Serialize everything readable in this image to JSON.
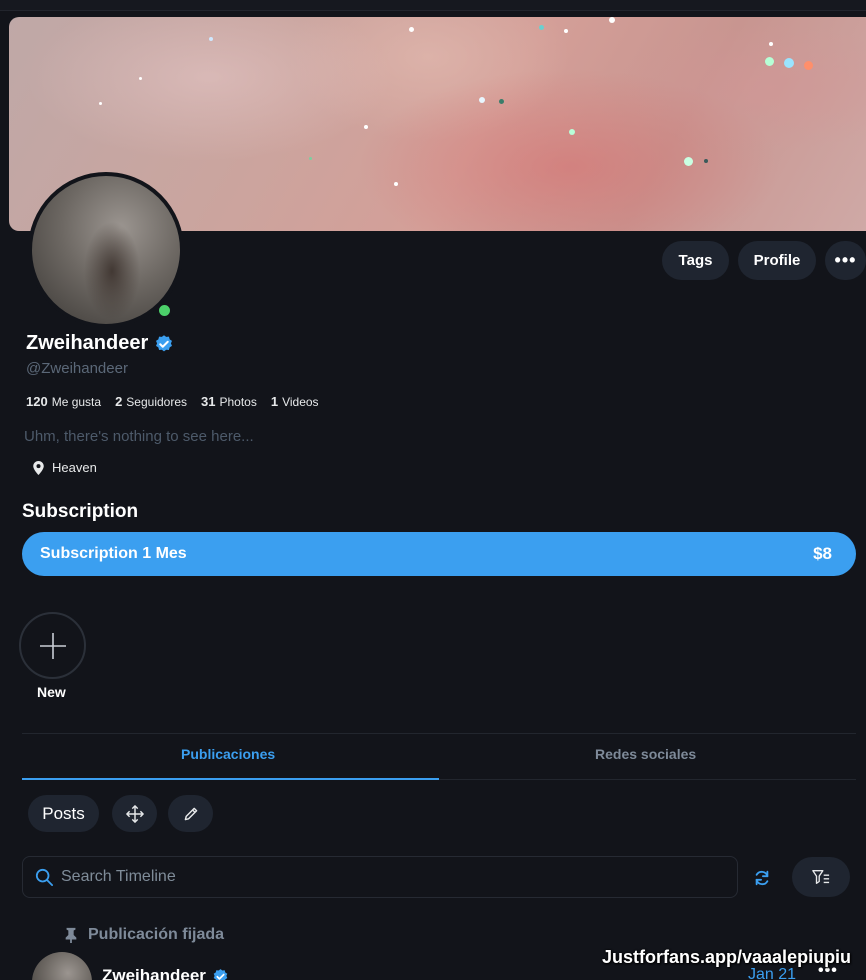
{
  "header": {
    "buttons": {
      "tags": "Tags",
      "profile": "Profile",
      "more": "•••"
    }
  },
  "profile": {
    "name": "Zweihandeer",
    "handle": "@Zweihandeer",
    "online": true,
    "stats": [
      {
        "value": "120",
        "label": "Me gusta"
      },
      {
        "value": "2",
        "label": "Seguidores"
      },
      {
        "value": "31",
        "label": "Photos"
      },
      {
        "value": "1",
        "label": "Videos"
      }
    ],
    "bio": "Uhm, there's nothing to see here...",
    "location": "Heaven"
  },
  "subscription": {
    "heading": "Subscription",
    "plan_label": "Subscription 1 Mes",
    "price": "$8"
  },
  "stories": {
    "new_label": "New"
  },
  "tabs": [
    {
      "label": "Publicaciones",
      "active": true
    },
    {
      "label": "Redes sociales",
      "active": false
    }
  ],
  "toolbar": {
    "posts_label": "Posts"
  },
  "search": {
    "placeholder": "Search Timeline",
    "value": ""
  },
  "pinned_post": {
    "pinned_label": "Publicación fijada",
    "author": "Zweihandeer",
    "date": "Jan 21",
    "more": "•••"
  },
  "watermark": "Justforfans.app/vaaalepiupiu",
  "colors": {
    "accent": "#3b9ff0",
    "background": "#12141a",
    "button_bg": "#1f2530",
    "online": "#4cd06a"
  },
  "icons": [
    "verified-badge-icon",
    "map-pin-icon",
    "plus-icon",
    "move-icon",
    "pencil-icon",
    "search-icon",
    "refresh-icon",
    "filter-icon",
    "pin-icon"
  ]
}
